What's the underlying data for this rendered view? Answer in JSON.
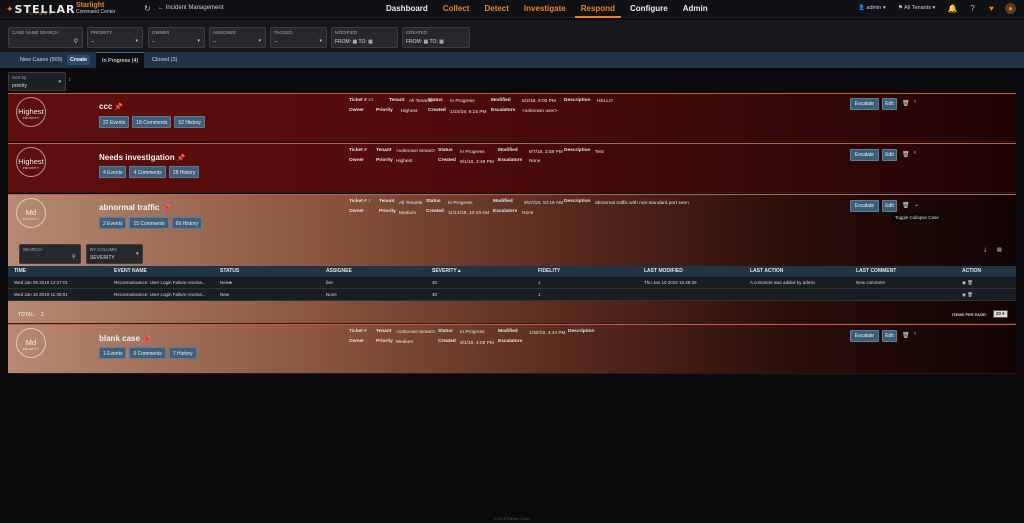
{
  "header": {
    "logo": "STELLAR",
    "logo_sub": "CYBER",
    "product": "Starlight",
    "product_sub": "Command Center",
    "breadcrumb": "Incident Management",
    "nav": [
      "Dashboard",
      "Collect",
      "Detect",
      "Investigate",
      "Respond",
      "Configure",
      "Admin"
    ],
    "user": "admin ▾",
    "tenant": "All Tenants ▾"
  },
  "filters": {
    "case_name_label": "CASE NAME SEARCH",
    "priority_label": "PRIORITY",
    "priority_value": "--",
    "owner_label": "OWNER",
    "owner_value": "--",
    "assignee_label": "ASSIGNEE",
    "assignee_value": "--",
    "tagged_label": "TAGGED",
    "tagged_value": "--",
    "modified_label": "MODIFIED",
    "created_label": "CREATED",
    "from_label": "FROM:",
    "to_label": "TO:"
  },
  "tabs": {
    "new_cases": "New Cases (509)",
    "create": "Create",
    "in_progress": "In Progress (4)",
    "closed": "Closed (3)"
  },
  "sort": {
    "label": "Sort by",
    "value": "priority"
  },
  "meta_labels": {
    "ticket": "Ticket #",
    "tenant": "Tenant",
    "status": "Status",
    "modified": "Modified",
    "description": "Description",
    "owner": "Owner",
    "priority": "Priority",
    "created": "Created",
    "escalators": "Escalators"
  },
  "buttons": {
    "escalate": "Escalate",
    "edit": "Edit"
  },
  "cases": [
    {
      "priority_badge": "Highest",
      "badge_sub": "PRIORITY",
      "title": "ccc",
      "events": "22 Events",
      "comments": "18 Comments",
      "history": "52 History",
      "ticket": "24",
      "tenant": "All Tenants",
      "status": "In Progress",
      "modified": "5/2/19, 6:00 PM",
      "description": "HELLO",
      "owner": "",
      "priority": "Highest",
      "created": "1/24/19, 6:15 PM",
      "escalators": "<unknown user>"
    },
    {
      "priority_badge": "Highest",
      "badge_sub": "PRIORITY",
      "title": "Needs investigation",
      "events": "4 Events",
      "comments": "4 Comments",
      "history": "28 History",
      "ticket": "",
      "tenant": "<unknown tenant>",
      "status": "In Progress",
      "modified": "9/7/18, 2:58 PM",
      "description": "Test",
      "owner": "",
      "priority": "Highest",
      "created": "9/1/18, 3:49 PM",
      "escalators": "None"
    },
    {
      "priority_badge": "Md",
      "badge_sub": "PRIORITY",
      "title": "abnormal traffic",
      "events": "2 Events",
      "comments": "15 Comments",
      "history": "69 History",
      "ticket": "1",
      "tenant": "All Tenants",
      "status": "In Progress",
      "modified": "9/27/18, 10:16 AM",
      "description": "abnormal traffic with non-standard port seen",
      "owner": "",
      "priority": "Medium",
      "created": "11/14/18, 10:19 AM",
      "escalators": "None"
    },
    {
      "priority_badge": "Md",
      "badge_sub": "PRIORITY",
      "title": "blank case",
      "events": "1 Events",
      "comments": "0 Comments",
      "history": "7 History",
      "ticket": "",
      "tenant": "<unknown tenant>",
      "status": "In Progress",
      "modified": "1/30/19, 4:44 PM",
      "description": "",
      "owner": "",
      "priority": "Medium",
      "created": "9/1/18, 4:00 PM",
      "escalators": ""
    }
  ],
  "tooltip": "Toggle Collapse Case",
  "inner": {
    "search_label": "SEARCH",
    "column_label": "BY COLUMN",
    "column_value": "SEVERITY"
  },
  "events_table": {
    "headers": [
      "TIME",
      "EVENT NAME",
      "STATUS",
      "ASSIGNEE",
      "SEVERITY▲",
      "FIDELITY",
      "LAST MODIFIED",
      "LAST ACTION",
      "LAST COMMENT",
      "ACTION"
    ],
    "rows": [
      [
        "Wed Jan 09 2019 12:27:01",
        "Reconnaissance: User Login Failure Anoma...",
        "New♣",
        "live",
        "30",
        "1",
        "Thu Jan 10 2019 15:49:30",
        "A comment was added by admin",
        "New comment",
        ""
      ],
      [
        "Wed Jan 16 2019 11:36:01",
        "Reconnaissance: User Login Failure Anoma...",
        "New",
        "None",
        "30",
        "1",
        "",
        "",
        "",
        ""
      ]
    ],
    "total_label": "TOTAL:",
    "total": "2",
    "items_per_page_label": "ITEMS PER PAGE:",
    "items_per_page": "20 ▾"
  },
  "footer": "©2019 Stellar Cyber",
  "colors": {
    "accent": "#e8822f",
    "nav_active": "#e8822f",
    "button": "#3c5d78",
    "table_header": "#203444"
  }
}
